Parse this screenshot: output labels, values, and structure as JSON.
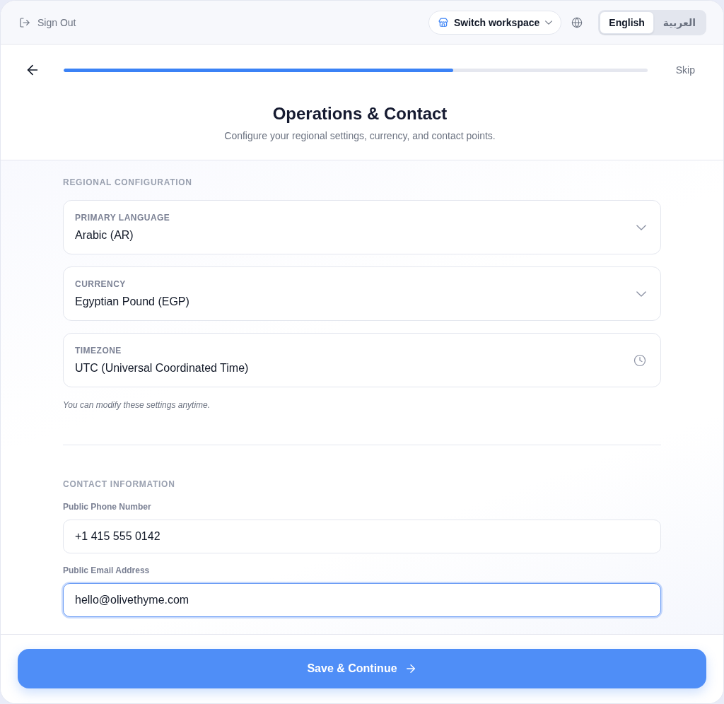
{
  "top_bar": {
    "sign_out": "Sign Out",
    "workspace_button": "Switch workspace",
    "languages": [
      {
        "label": "English",
        "selected": true
      },
      {
        "label": "العربية",
        "selected": false
      }
    ]
  },
  "header": {
    "progress": {
      "level": 0.667
    },
    "skip": "Skip",
    "title": "Operations & Contact",
    "subtitle": "Configure your regional settings, currency, and contact points."
  },
  "regional": {
    "heading": "REGIONAL CONFIGURATION",
    "fields": [
      {
        "kind": "select",
        "label": "PRIMARY LANGUAGE",
        "value": "Arabic (AR)"
      },
      {
        "kind": "select",
        "label": "CURRENCY",
        "value": "Egyptian Pound (EGP)"
      },
      {
        "kind": "time",
        "label": "TIMEZONE",
        "value": "UTC (Universal Coordinated Time)"
      }
    ],
    "note": "You can modify these settings anytime."
  },
  "contact": {
    "heading": "CONTACT INFORMATION",
    "fields": [
      {
        "label": "Public Phone Number",
        "value": "+1 415 555 0142",
        "focused": false
      },
      {
        "label": "Public Email Address",
        "value": "hello@olivethyme.com",
        "focused": true
      }
    ]
  },
  "footer": {
    "button": "Save & Continue"
  }
}
